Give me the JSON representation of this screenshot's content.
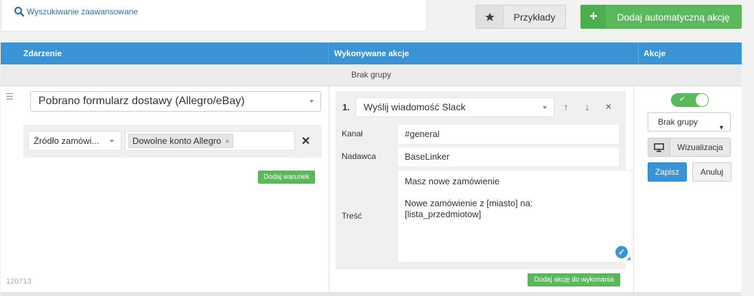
{
  "search": {
    "link_label": "Wyszukiwanie zaawansowane"
  },
  "toolbar": {
    "examples_label": "Przykłady",
    "add_label": "Dodaj automatyczną akcję",
    "add_icon": "+"
  },
  "table": {
    "headers": {
      "event": "Zdarzenie",
      "actions": "Wykonywane akcje",
      "controls": "Akcje"
    },
    "group_label": "Brak grupy"
  },
  "rule": {
    "event_value": "Pobrano formularz dostawy (Allegro/eBay)",
    "condition": {
      "source_value": "Źródło zamówi...",
      "tag_value": "Dowolne konto Allegro",
      "tag_remove": "×",
      "delete_glyph": "✕"
    },
    "add_condition_label": "Dodaj warunek",
    "id": "120713",
    "action": {
      "number": "1.",
      "type_value": "Wyślij wiadomość Slack",
      "up_glyph": "↑",
      "down_glyph": "↓",
      "delete_glyph": "✕",
      "fields": {
        "channel_label": "Kanał",
        "channel_value": "#general",
        "sender_label": "Nadawca",
        "sender_value": "BaseLinker",
        "content_label": "Treść",
        "content_value": "Masz nowe zamówienie\n\nNowe zamówienie z [miasto] na:\n[lista_przedmiotow]"
      }
    },
    "add_action_label": "Dodaj akcję do wykonania",
    "controls": {
      "toggle_on": true,
      "group_select_value": "Brak grupy",
      "visualize_label": "Wizualizacja",
      "save_label": "Zapisz",
      "cancel_label": "Anuluj"
    }
  },
  "colors": {
    "header_blue": "#3993d5",
    "success_green": "#5cb85c",
    "link_blue": "#2e6da4"
  }
}
